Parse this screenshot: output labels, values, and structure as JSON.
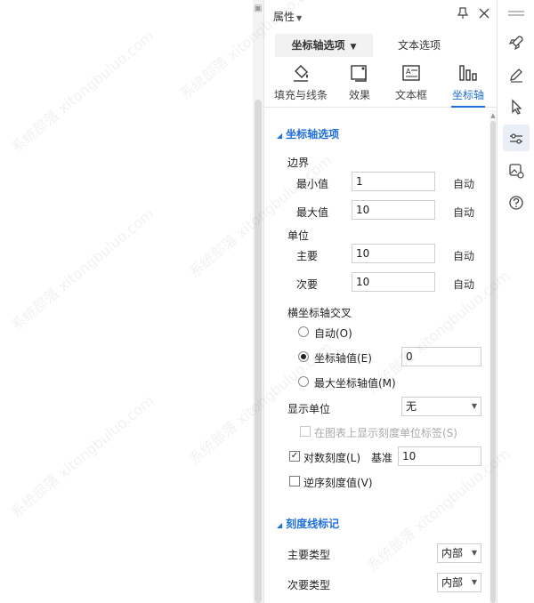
{
  "panel": {
    "title": "属性",
    "tabs": [
      {
        "label": "坐标轴选项",
        "active": true
      },
      {
        "label": "文本选项",
        "active": false
      }
    ],
    "subtabs": [
      {
        "label": "填充与线条",
        "icon": "fill-bucket-icon"
      },
      {
        "label": "效果",
        "icon": "effects-icon"
      },
      {
        "label": "文本框",
        "icon": "textbox-icon"
      },
      {
        "label": "坐标轴",
        "icon": "axis-bars-icon",
        "active": true
      }
    ]
  },
  "axis_options": {
    "section_title": "坐标轴选项",
    "bounds": {
      "label": "边界",
      "min_label": "最小值",
      "min_value": "1",
      "max_label": "最大值",
      "max_value": "10",
      "auto_label": "自动"
    },
    "units": {
      "label": "单位",
      "major_label": "主要",
      "major_value": "10",
      "minor_label": "次要",
      "minor_value": "10",
      "auto_label": "自动"
    },
    "crosses": {
      "label": "横坐标轴交叉",
      "options": [
        {
          "label": "自动(O)",
          "checked": false
        },
        {
          "label": "坐标轴值(E)",
          "checked": true
        },
        {
          "label": "最大坐标轴值(M)",
          "checked": false
        }
      ],
      "axis_value": "0"
    },
    "display_units": {
      "label": "显示单位",
      "selected": "无",
      "show_label_checkbox": "在图表上显示刻度单位标签(S)"
    },
    "log_scale": {
      "label": "对数刻度(L)",
      "checked": true,
      "base_label": "基准",
      "base_value": "10"
    },
    "reverse_order": {
      "label": "逆序刻度值(V)",
      "checked": false
    }
  },
  "tick_marks": {
    "section_title": "刻度线标记",
    "major_type_label": "主要类型",
    "major_type_value": "内部",
    "minor_type_label": "次要类型",
    "minor_type_value": "内部"
  },
  "rail": {
    "items": [
      "rocket-icon",
      "pen-icon",
      "cursor-icon",
      "sliders-icon",
      "image-settings-icon",
      "help-icon"
    ]
  },
  "watermark": "系统部落 xitongbuluo.com",
  "colors": {
    "accent": "#1e6fd9",
    "border": "#cfcfcf",
    "disabled_text": "#aaaaaa"
  }
}
